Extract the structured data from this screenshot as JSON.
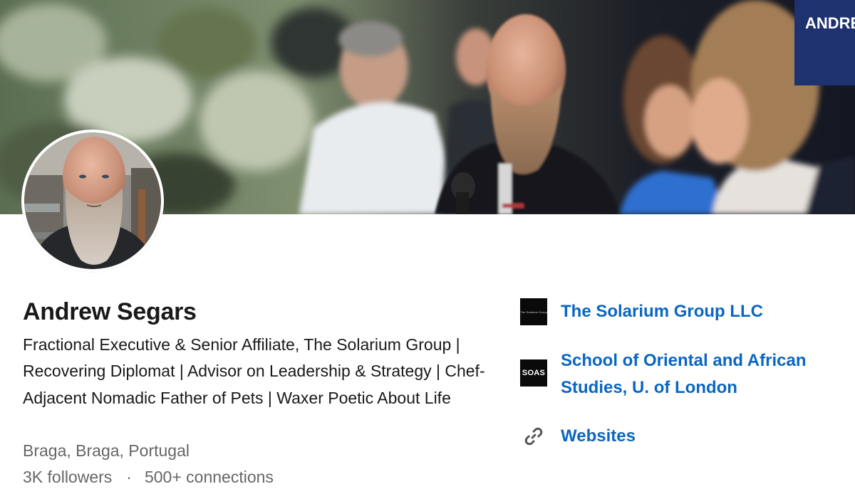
{
  "profile": {
    "name": "Andrew Segars",
    "headline": "Fractional Executive & Senior Affiliate, The Solarium Group | Recovering Diplomat | Advisor on Leadership & Strategy | Chef-Adjacent Nomadic Father of Pets | Waxer Poetic About Life",
    "location": "Braga, Braga, Portugal",
    "followers": "3K followers",
    "separator": "·",
    "connections": "500+ connections"
  },
  "sidebar": {
    "company": {
      "name": "The Solarium Group LLC",
      "logo_text": "The Solarium Group"
    },
    "school": {
      "name": "School of Oriental and African Studies, U. of London",
      "logo_text": "SOAS"
    },
    "websites_label": "Websites"
  },
  "banner": {
    "backdrop_text": "ANDREW SE"
  },
  "colors": {
    "link": "#0a66c2",
    "text_primary": "#191919",
    "text_secondary": "#666666",
    "background": "#ffffff"
  },
  "icons": {
    "websites": "link-icon"
  }
}
